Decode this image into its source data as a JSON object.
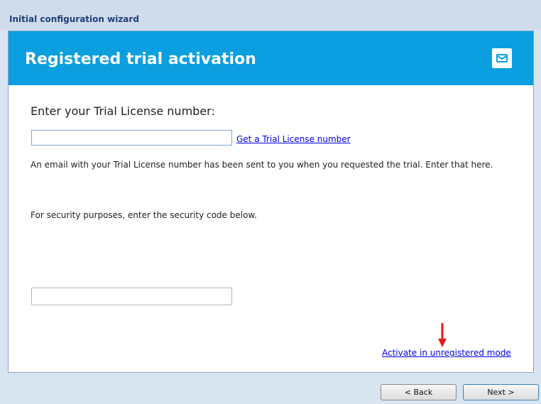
{
  "window": {
    "title": "Initial configuration wizard"
  },
  "header": {
    "title": "Registered trial activation",
    "icon": "mail-icon",
    "bg_color": "#0c9fe0"
  },
  "form": {
    "heading": "Enter your Trial License number:",
    "license_value": "",
    "get_license_link": "Get a Trial License number",
    "description": "An email with your Trial License number has been sent to you when you requested the trial. Enter that here.",
    "security_text": "For security purposes, enter the security code below.",
    "security_value": "",
    "unregistered_link": "Activate in unregistered mode"
  },
  "buttons": {
    "back": "< Back",
    "next": "Next >"
  }
}
